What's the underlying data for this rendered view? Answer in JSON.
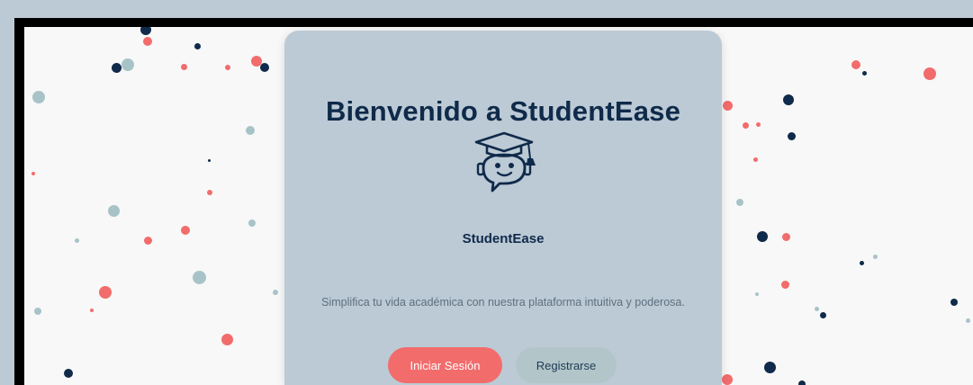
{
  "welcome": {
    "title": "Bienvenido a StudentEase",
    "brand_name": "StudentEase",
    "tagline": "Simplifica tu vida académica con nuestra plataforma intuitiva y poderosa.",
    "login_label": "Iniciar Sesión",
    "register_label": "Registrarse",
    "logo_icon": "graduation-cap-robot-logo-icon"
  },
  "colors": {
    "navy": "#0f2a4a",
    "coral": "#f26c6c",
    "teal": "#a8c3c8",
    "card": "#bccad5"
  }
}
